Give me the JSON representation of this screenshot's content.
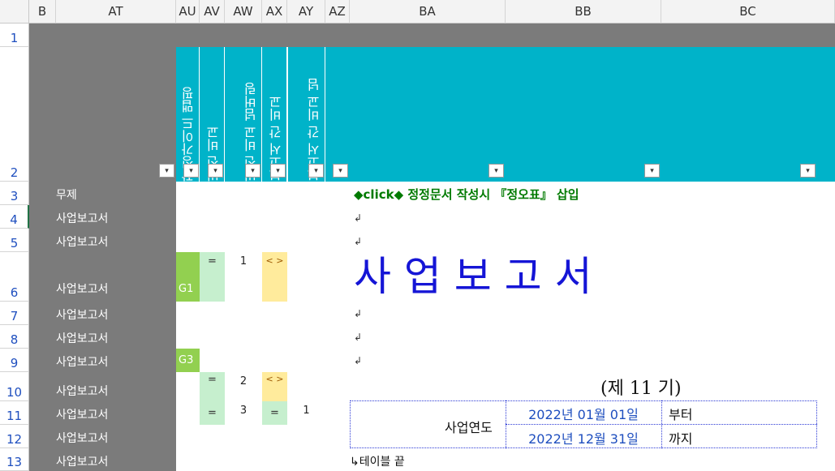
{
  "columns": {
    "B": "B",
    "AT": "AT",
    "AU": "AU",
    "AV": "AV",
    "AW": "AW",
    "AX": "AX",
    "AY": "AY",
    "AZ": "AZ",
    "BA": "BA",
    "BB": "BB",
    "BC": "BC"
  },
  "rows": [
    "1",
    "2",
    "3",
    "4",
    "5",
    "6",
    "7",
    "8",
    "9",
    "10",
    "11",
    "12",
    "13"
  ],
  "vertical_headers": [
    "작성가이드 맵핑",
    "버전 비교",
    "버전 비교 넘버링",
    "보고서 간 비교",
    "보고서 간 비교 넘"
  ],
  "filter_glyph": "▾",
  "row_labels": {
    "r3": "무제",
    "r4": "사업보고서",
    "r5": "사업보고서",
    "r6": "사업보고서",
    "r7": "사업보고서",
    "r8": "사업보고서",
    "r9": "사업보고서",
    "r10": "사업보고서",
    "r11": "사업보고서",
    "r12": "사업보고서",
    "r13": "사업보고서"
  },
  "compare": {
    "g1": "G1",
    "g3": "G3",
    "eq": "=",
    "neq": "< >",
    "n1": "1",
    "n2": "2",
    "n3": "3",
    "n_ay": "1"
  },
  "doc": {
    "click_line": "◆click◆ 정정문서 작성시 『정오표』 삽입",
    "return_mark": "↲",
    "title": "사 업 보 고 서",
    "period": "(제 11 기)",
    "fiscal_label": "사업연도",
    "date_from": "2022년 01월 01일",
    "from_word": "부터",
    "date_to": "2022년 12월 31일",
    "to_word": "까지",
    "table_end": "↳테이블 끝"
  },
  "colors": {
    "teal": "#00b3c9",
    "gray": "#7b7b7b",
    "blue_title": "#1515d6",
    "green_text": "#007a00"
  }
}
